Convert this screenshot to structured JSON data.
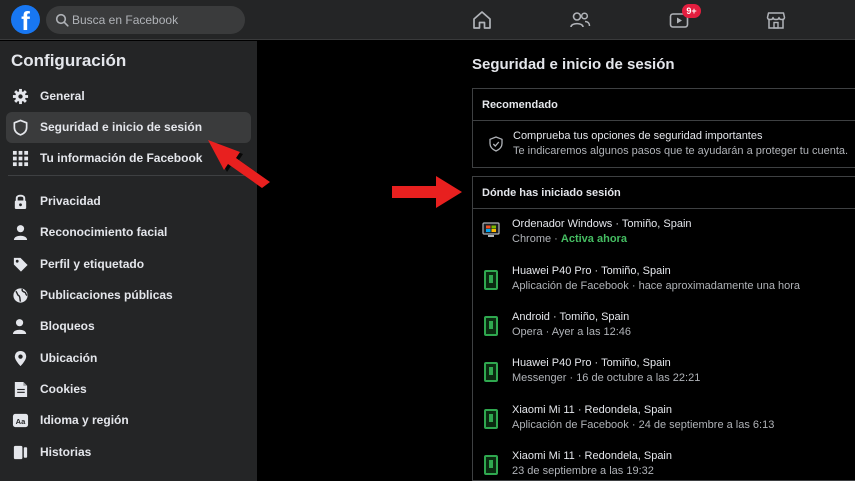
{
  "header": {
    "logo": "f",
    "search_placeholder": "Busca en Facebook",
    "badge": "9+"
  },
  "sidebar": {
    "title": "Configuración",
    "items": [
      {
        "label": "General",
        "icon": "gear-icon"
      },
      {
        "label": "Seguridad e inicio de sesión",
        "icon": "shield-icon"
      },
      {
        "label": "Tu información de Facebook",
        "icon": "grid-icon"
      },
      {
        "label": "Privacidad",
        "icon": "lock-icon"
      },
      {
        "label": "Reconocimiento facial",
        "icon": "person-icon"
      },
      {
        "label": "Perfil y etiquetado",
        "icon": "tag-icon"
      },
      {
        "label": "Publicaciones públicas",
        "icon": "globe-icon"
      },
      {
        "label": "Bloqueos",
        "icon": "block-user-icon"
      },
      {
        "label": "Ubicación",
        "icon": "location-pin-icon"
      },
      {
        "label": "Cookies",
        "icon": "cookie-icon"
      },
      {
        "label": "Idioma y región",
        "icon": "language-icon"
      },
      {
        "label": "Historias",
        "icon": "stories-icon"
      }
    ]
  },
  "main": {
    "title": "Seguridad e inicio de sesión",
    "recommended": {
      "header": "Recomendado",
      "line1": "Comprueba tus opciones de seguridad importantes",
      "line2": "Te indicaremos algunos pasos que te ayudarán a proteger tu cuenta."
    },
    "sessions": {
      "header": "Dónde has iniciado sesión",
      "items": [
        {
          "device": "Ordenador Windows · Tomiño, Spain",
          "detail": "Chrome · ",
          "active": "Activa ahora",
          "icon": "windows-desktop-icon"
        },
        {
          "device": "Huawei P40 Pro · Tomiño, Spain",
          "detail": "Aplicación de Facebook · hace aproximadamente una hora",
          "icon": "phone-icon"
        },
        {
          "device": "Android · Tomiño, Spain",
          "detail": "Opera · Ayer a las 12:46",
          "icon": "phone-icon"
        },
        {
          "device": "Huawei P40 Pro · Tomiño, Spain",
          "detail": "Messenger · 16 de octubre a las 22:21",
          "icon": "phone-icon"
        },
        {
          "device": "Xiaomi Mi 11 · Redondela, Spain",
          "detail": "Aplicación de Facebook · 24 de septiembre a las 6:13",
          "icon": "phone-icon"
        },
        {
          "device": "Xiaomi Mi 11 · Redondela, Spain",
          "detail": "23 de septiembre a las 19:32",
          "icon": "phone-icon"
        }
      ]
    }
  },
  "colors": {
    "accent": "#1877f2",
    "active_green": "#45bd62",
    "arrow_red": "#e8201f"
  }
}
